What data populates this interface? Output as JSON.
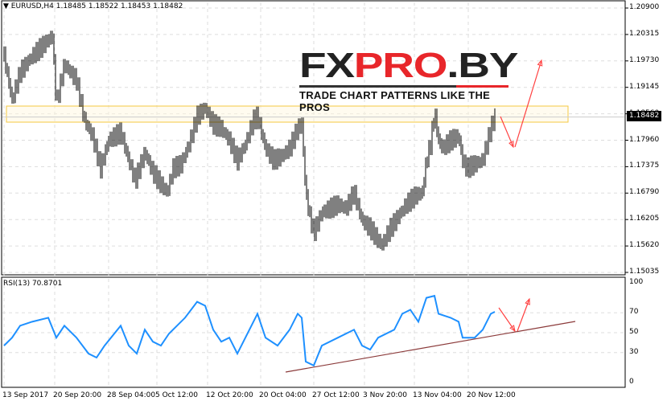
{
  "header": {
    "symbol": "EURUSD,H4",
    "open": "1.18485",
    "high": "1.18522",
    "low": "1.18453",
    "close": "1.18482"
  },
  "logo": {
    "brand_dark": "FX",
    "brand_red": "PRO",
    "brand_dark2": ".BY",
    "tagline": "TRADE CHART PATTERNS LIKE THE PROS"
  },
  "rsi_label": "RSI(13) 70.8701",
  "last_price": "1.18482",
  "price_axis": [
    "1.20900",
    "1.20315",
    "1.19730",
    "1.19145",
    "1.18560",
    "1.17960",
    "1.17375",
    "1.16790",
    "1.16205",
    "1.15620",
    "1.15035"
  ],
  "rsi_axis": [
    "100",
    "70",
    "50",
    "30",
    "0"
  ],
  "dates": [
    "13 Sep 2017",
    "20 Sep 20:00",
    "28 Sep 04:00",
    "5 Oct 12:00",
    "12 Oct 20:00",
    "20 Oct 04:00",
    "27 Oct 12:00",
    "3 Nov 20:00",
    "13 Nov 04:00",
    "20 Nov 12:00"
  ],
  "colors": {
    "rsi": "#1e90ff",
    "trend": "#8b3a3a",
    "arrow": "#ff4040",
    "zone": "#f5c842"
  },
  "chart_data": {
    "type": "line",
    "price": {
      "ylim": [
        1.15035,
        1.209
      ],
      "points": [
        [
          0,
          1.19833
        ],
        [
          2,
          1.18855
        ],
        [
          4,
          1.19478
        ],
        [
          7,
          1.19833
        ],
        [
          10,
          1.201
        ],
        [
          12,
          1.20278
        ],
        [
          13,
          1.18767
        ],
        [
          15,
          1.19655
        ],
        [
          18,
          1.193
        ],
        [
          20,
          1.18411
        ],
        [
          22,
          1.18055
        ],
        [
          24,
          1.17344
        ],
        [
          26,
          1.17966
        ],
        [
          29,
          1.18144
        ],
        [
          31,
          1.17522
        ],
        [
          32.6,
          1.17077
        ],
        [
          35,
          1.177
        ],
        [
          37,
          1.17255
        ],
        [
          39,
          1.16988
        ],
        [
          40.6,
          1.1681
        ],
        [
          42,
          1.17344
        ],
        [
          44,
          1.17433
        ],
        [
          46,
          1.17877
        ],
        [
          48,
          1.185
        ],
        [
          50,
          1.18678
        ],
        [
          52,
          1.18322
        ],
        [
          54,
          1.18233
        ],
        [
          56,
          1.17966
        ],
        [
          58,
          1.17522
        ],
        [
          60,
          1.17877
        ],
        [
          62,
          1.18411
        ],
        [
          63,
          1.185
        ],
        [
          65,
          1.17789
        ],
        [
          67,
          1.17522
        ],
        [
          69,
          1.17611
        ],
        [
          71,
          1.17789
        ],
        [
          73,
          1.18233
        ],
        [
          74,
          1.18322
        ],
        [
          75,
          1.1681
        ],
        [
          76,
          1.16277
        ],
        [
          77,
          1.15922
        ],
        [
          79,
          1.16366
        ],
        [
          81,
          1.16455
        ],
        [
          83,
          1.16544
        ],
        [
          85,
          1.16455
        ],
        [
          87,
          1.1681
        ],
        [
          89,
          1.16188
        ],
        [
          91,
          1.1601
        ],
        [
          93,
          1.15744
        ],
        [
          94,
          1.15655
        ],
        [
          96,
          1.1601
        ],
        [
          98,
          1.16277
        ],
        [
          100,
          1.16544
        ],
        [
          102,
          1.16722
        ],
        [
          104,
          1.1681
        ],
        [
          105,
          1.17522
        ],
        [
          106,
          1.17877
        ],
        [
          107,
          1.18589
        ],
        [
          108,
          1.17966
        ],
        [
          109,
          1.17789
        ],
        [
          111,
          1.17966
        ],
        [
          113,
          1.18055
        ],
        [
          114,
          1.17522
        ],
        [
          115,
          1.17344
        ],
        [
          117,
          1.17433
        ],
        [
          119,
          1.17522
        ],
        [
          120,
          1.17877
        ],
        [
          121,
          1.18233
        ],
        [
          122,
          1.18482
        ]
      ]
    },
    "rsi": {
      "ylim": [
        0,
        100
      ],
      "levels": [
        70,
        50,
        30
      ],
      "points": [
        [
          0,
          37
        ],
        [
          2,
          45
        ],
        [
          4,
          57
        ],
        [
          7,
          61
        ],
        [
          11,
          65
        ],
        [
          13,
          45
        ],
        [
          15,
          57
        ],
        [
          18,
          45
        ],
        [
          21,
          29
        ],
        [
          23,
          25
        ],
        [
          25,
          37
        ],
        [
          29,
          57
        ],
        [
          31,
          37
        ],
        [
          33,
          29
        ],
        [
          35,
          53
        ],
        [
          37,
          41
        ],
        [
          39,
          37
        ],
        [
          41,
          49
        ],
        [
          45,
          65
        ],
        [
          48,
          81
        ],
        [
          50,
          77
        ],
        [
          52,
          53
        ],
        [
          54,
          41
        ],
        [
          56,
          45
        ],
        [
          58,
          29
        ],
        [
          60,
          45
        ],
        [
          63,
          69
        ],
        [
          65,
          45
        ],
        [
          68,
          37
        ],
        [
          71,
          53
        ],
        [
          73,
          69
        ],
        [
          74,
          65
        ],
        [
          75,
          21
        ],
        [
          77,
          17
        ],
        [
          79,
          37
        ],
        [
          83,
          45
        ],
        [
          87,
          53
        ],
        [
          89,
          37
        ],
        [
          91,
          33
        ],
        [
          93,
          45
        ],
        [
          97,
          53
        ],
        [
          99,
          69
        ],
        [
          101,
          73
        ],
        [
          103,
          61
        ],
        [
          105,
          85
        ],
        [
          107,
          87
        ],
        [
          108,
          69
        ],
        [
          111,
          65
        ],
        [
          113,
          61
        ],
        [
          114,
          45
        ],
        [
          115,
          45
        ],
        [
          117,
          45
        ],
        [
          119,
          53
        ],
        [
          121,
          69
        ],
        [
          122,
          71
        ]
      ]
    }
  }
}
